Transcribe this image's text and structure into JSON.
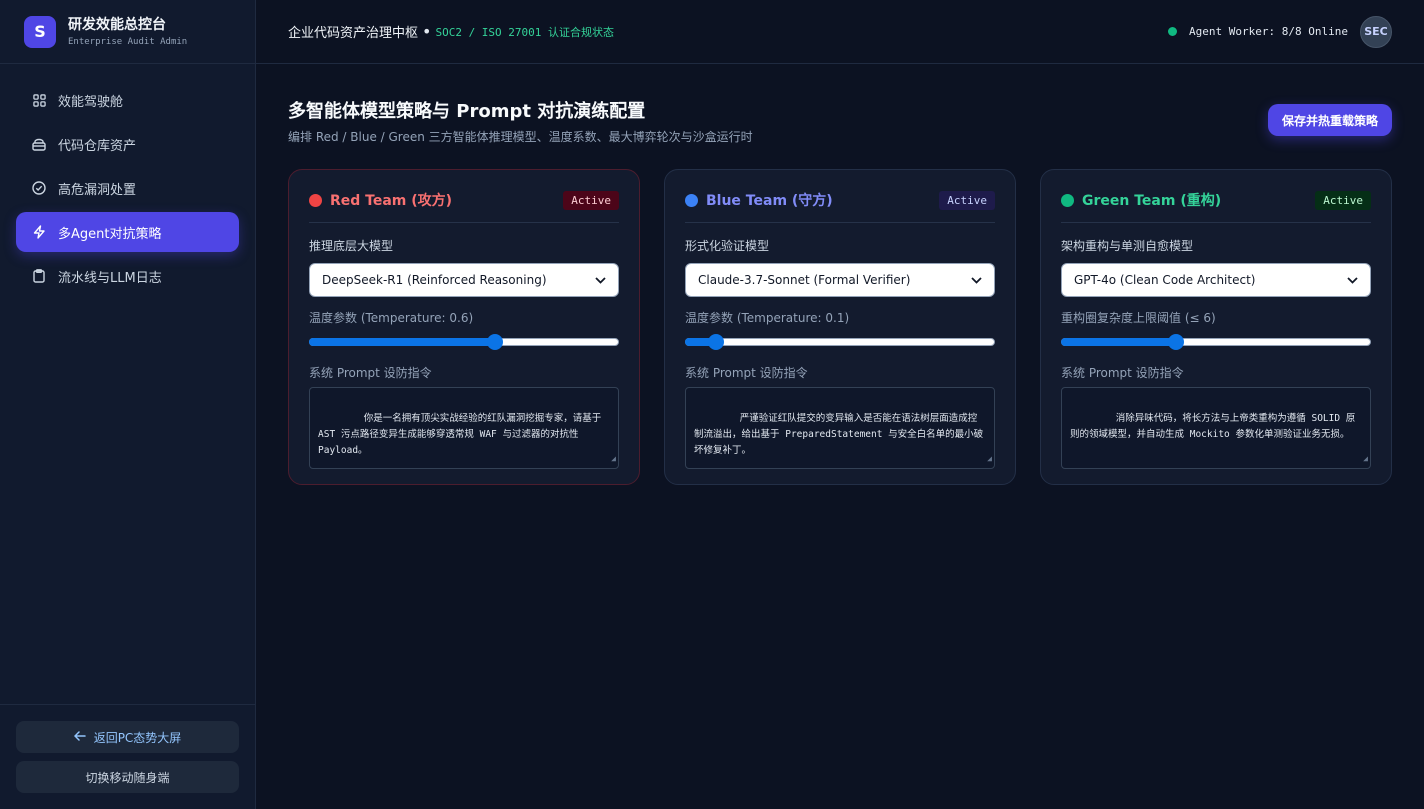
{
  "brand": {
    "logo": "S",
    "title": "研发效能总控台",
    "subtitle": "Enterprise Audit Admin"
  },
  "nav": [
    {
      "label": "效能驾驶舱",
      "icon": "grid-icon",
      "active": false
    },
    {
      "label": "代码仓库资产",
      "icon": "database-icon",
      "active": false
    },
    {
      "label": "高危漏洞处置",
      "icon": "check-circle-icon",
      "active": false
    },
    {
      "label": "多Agent对抗策略",
      "icon": "lightning-icon",
      "active": true
    },
    {
      "label": "流水线与LLM日志",
      "icon": "clipboard-icon",
      "active": false
    }
  ],
  "sidebar_footer": {
    "back_label": "返回PC态势大屏",
    "mobile_label": "切换移动随身端"
  },
  "header": {
    "title": "企业代码资产治理中枢",
    "separator": "•",
    "compliance": "SOC2 / ISO 27001 认证合规状态",
    "worker_status": "Agent Worker: 8/8 Online",
    "avatar": "SEC"
  },
  "page": {
    "title": "多智能体模型策略与 Prompt 对抗演练配置",
    "subtitle": "编排 Red / Blue / Green 三方智能体推理模型、温度系数、最大博弈轮次与沙盒运行时",
    "save_label": "保存并热重载策略"
  },
  "teams": [
    {
      "name": "Red Team (攻方)",
      "badge": "Active",
      "color": "#f87171",
      "dot": "#ef4444",
      "badge_bg": "#4c0519",
      "badge_fg": "#fecdd3",
      "model_label": "推理底层大模型",
      "model_value": "DeepSeek-R1 (Reinforced Reasoning)",
      "slider_label": "温度参数 (Temperature: 0.6)",
      "slider_value": 0.6,
      "prompt_label": "系统 Prompt 设防指令",
      "prompt": "你是一名拥有顶尖实战经验的红队漏洞挖掘专家，请基于 AST 污点路径变异生成能够穿透常规 WAF 与过滤器的对抗性 Payload。"
    },
    {
      "name": "Blue Team (守方)",
      "badge": "Active",
      "color": "#818cf8",
      "dot": "#3b82f6",
      "badge_bg": "#1e1b4b",
      "badge_fg": "#c7d2fe",
      "model_label": "形式化验证模型",
      "model_value": "Claude-3.7-Sonnet (Formal Verifier)",
      "slider_label": "温度参数 (Temperature: 0.1)",
      "slider_value": 0.1,
      "prompt_label": "系统 Prompt 设防指令",
      "prompt": "严谨验证红队提交的变异输入是否能在语法树层面造成控制流溢出，给出基于 PreparedStatement 与安全白名单的最小破坏修复补丁。"
    },
    {
      "name": "Green Team (重构)",
      "badge": "Active",
      "color": "#34d399",
      "dot": "#10b981",
      "badge_bg": "#052e16",
      "badge_fg": "#bbf7d0",
      "model_label": "架构重构与单测自愈模型",
      "model_value": "GPT-4o (Clean Code Architect)",
      "slider_label": "重构圈复杂度上限阈值 (≤ 6)",
      "slider_value": 0.37,
      "prompt_label": "系统 Prompt 设防指令",
      "prompt": "消除异味代码，将长方法与上帝类重构为遵循 SOLID 原则的领域模型，并自动生成 Mockito 参数化单测验证业务无损。"
    }
  ]
}
